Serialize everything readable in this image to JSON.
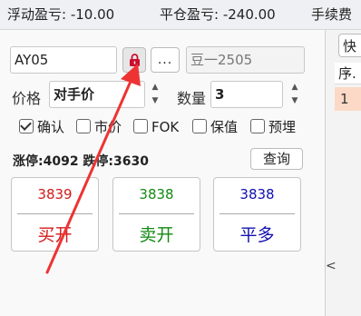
{
  "topbar": {
    "float_pnl": "浮动盈亏: -10.00",
    "close_pnl": "平仓盈亏: -240.00",
    "fee": "手续费"
  },
  "order": {
    "contract": "AY05",
    "contract_name": "豆一2505",
    "dots_label": "...",
    "price_label": "价格",
    "price_value": "对手价",
    "qty_label": "数量",
    "qty_value": "3"
  },
  "options": {
    "confirm": "确认",
    "market": "市价",
    "fok": "FOK",
    "hedge": "保值",
    "preset": "预埋"
  },
  "limits": {
    "text": "涨停:4092 跌停:3630"
  },
  "query_label": "查询",
  "buttons": {
    "buy_open": {
      "price": "3839",
      "label": "买开",
      "color": "#d11a1a"
    },
    "sell_open": {
      "price": "3838",
      "label": "卖开",
      "color": "#138a13"
    },
    "close_long": {
      "price": "3838",
      "label": "平多",
      "color": "#1010b0"
    }
  },
  "right": {
    "fast_label": "快",
    "col_head": "序.",
    "row1": "1",
    "collapse_glyph": "<"
  },
  "icons": {
    "lock": "lock-icon",
    "arrow": "annotation-arrow"
  },
  "colors": {
    "lock_red": "#c8102e",
    "arrow_red": "#ee3333",
    "row_highlight": "#fcd9c6"
  }
}
